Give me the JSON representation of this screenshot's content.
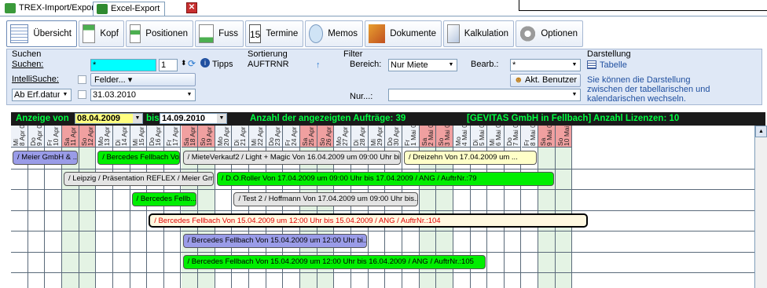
{
  "top_tabs": [
    {
      "label": "TREX-Import/Export",
      "icon": "trex-icon"
    },
    {
      "label": "Excel-Export",
      "icon": "excel-icon"
    }
  ],
  "toolbar": {
    "tabs": [
      {
        "label": "Übersicht",
        "icon": "overview-icon"
      },
      {
        "label": "Kopf",
        "icon": "header-icon"
      },
      {
        "label": "Positionen",
        "icon": "positions-icon"
      },
      {
        "label": "Fuss",
        "icon": "footer-icon"
      },
      {
        "label": "Termine",
        "icon": "calendar-icon",
        "icon_text": "15"
      },
      {
        "label": "Memos",
        "icon": "memo-icon"
      },
      {
        "label": "Dokumente",
        "icon": "documents-icon"
      },
      {
        "label": "Kalkulation",
        "icon": "calculation-icon"
      },
      {
        "label": "Optionen",
        "icon": "options-icon"
      }
    ]
  },
  "search": {
    "title": "Suchen",
    "suchen_label": "Suchen:",
    "suchen_value": "*",
    "count_value": "1",
    "tipps_label": "Tipps",
    "intelli_label": "IntelliSuche:",
    "felder_label": "Felder...",
    "date_mode": "Ab Erf.datum",
    "date_value": "31.03.2010"
  },
  "sort": {
    "title": "Sortierung",
    "value": "AUFTRNR"
  },
  "filter": {
    "title": "Filter",
    "bereich_label": "Bereich:",
    "bereich_value": "Nur Miete",
    "bearb_label": "Bearb.:",
    "bearb_value": "*",
    "akt_button": "Akt. Benutzer",
    "nur_label": "Nur...:",
    "nur_value": ""
  },
  "display": {
    "title": "Darstellung",
    "tabelle_label": "Tabelle",
    "hint": "Sie können die Darstellung zwischen der tabellarischen und kalendarischen wechseln."
  },
  "calendar": {
    "anzeige_von": "Anzeige von",
    "from_date": "08.04.2009",
    "bis": "bis",
    "to_date": "14.09.2010",
    "count_text": "Anzahl der angezeigten Aufträge: 39",
    "license_text": "[GEVITAS GmbH in Fellbach] Anzahl Lizenzen: 10",
    "days": [
      {
        "label": "Mi\n8 Apr 09",
        "weekend": false
      },
      {
        "label": "Do\n9 Apr 09",
        "weekend": false
      },
      {
        "label": "Fr\n10 Apr 09",
        "weekend": false
      },
      {
        "label": "Sa\n11 Apr 09",
        "weekend": true
      },
      {
        "label": "So\n12 Apr 09",
        "weekend": true
      },
      {
        "label": "Mo\n13 Apr 09",
        "weekend": false
      },
      {
        "label": "Di\n14 Apr 09",
        "weekend": false
      },
      {
        "label": "Mi\n15 Apr 09",
        "weekend": false
      },
      {
        "label": "Do\n16 Apr 09",
        "weekend": false
      },
      {
        "label": "Fr\n17 Apr 09",
        "weekend": false
      },
      {
        "label": "Sa\n18 Apr 09",
        "weekend": true
      },
      {
        "label": "So\n19 Apr 09",
        "weekend": true
      },
      {
        "label": "Mo\n20 Apr 09",
        "weekend": false
      },
      {
        "label": "Di\n21 Apr 09",
        "weekend": false
      },
      {
        "label": "Mi\n22 Apr 09",
        "weekend": false
      },
      {
        "label": "Do\n23 Apr 09",
        "weekend": false
      },
      {
        "label": "Fr\n24 Apr 09",
        "weekend": false
      },
      {
        "label": "Sa\n25 Apr 09",
        "weekend": true
      },
      {
        "label": "So\n26 Apr 09",
        "weekend": true
      },
      {
        "label": "Mo\n27 Apr 09",
        "weekend": false
      },
      {
        "label": "Di\n28 Apr 09",
        "weekend": false
      },
      {
        "label": "Mi\n29 Apr 09",
        "weekend": false
      },
      {
        "label": "Do\n30 Apr 09",
        "weekend": false
      },
      {
        "label": "Fr\n1 Mai 09",
        "weekend": false
      },
      {
        "label": "Sa\n2 Mai 09",
        "weekend": true
      },
      {
        "label": "So\n3 Mai 09",
        "weekend": true
      },
      {
        "label": "Mo\n4 Mai 09",
        "weekend": false
      },
      {
        "label": "Di\n5 Mai 09",
        "weekend": false
      },
      {
        "label": "Mi\n6 Mai 09",
        "weekend": false
      },
      {
        "label": "Do\n7 Mai 09",
        "weekend": false
      },
      {
        "label": "Fr\n8 Mai 09",
        "weekend": false
      },
      {
        "label": "Sa\n9 Mai 09",
        "weekend": true
      },
      {
        "label": "So\n10 Mai 09",
        "weekend": true
      }
    ],
    "events": [
      {
        "text": "/ Meier GmbH & ...",
        "color": "purple",
        "row": 0,
        "start": 0,
        "span": 4
      },
      {
        "text": "/ Bercedes Fellbach Vo...",
        "color": "green",
        "row": 0,
        "start": 5,
        "span": 5
      },
      {
        "text": "/ MieteVerkauf2 / Light + Magic Von 16.04.2009 um 09:00 Uhr  bis 16...",
        "color": "gray",
        "row": 0,
        "start": 10,
        "span": 13
      },
      {
        "text": "/ Dreizehn Von 17.04.2009 um ...",
        "color": "yellow",
        "row": 0,
        "start": 23,
        "span": 8
      },
      {
        "text": "/ Leipzig / Präsentation REFLEX / Meier Gmb...",
        "color": "gray",
        "row": 1,
        "start": 3,
        "span": 9
      },
      {
        "text": "/ D.O.Roller Von 17.04.2009 um 09:00 Uhr  bis 17.04.2009 / ANG / AuftrNr.:79",
        "color": "green",
        "row": 1,
        "start": 12,
        "span": 20
      },
      {
        "text": "/ Bercedes Fellb...",
        "color": "green",
        "row": 2,
        "start": 7,
        "span": 4
      },
      {
        "text": "/ Test 2 / Hoffmann Von 17.04.2009 um 09:00 Uhr  bis...",
        "color": "gray",
        "row": 2,
        "start": 13,
        "span": 11
      },
      {
        "text": "/ Bercedes Fellbach Von 15.04.2009 um 12:00 Uhr  bis 15.04.2009 / ANG / AuftrNr.:104",
        "color": "red",
        "row": 3,
        "start": 8,
        "span": 26
      },
      {
        "text": "/ Bercedes Fellbach Von 15.04.2009 um 12:00 Uhr  bi...",
        "color": "purple",
        "row": 4,
        "start": 10,
        "span": 11
      },
      {
        "text": "/ Bercedes Fellbach Von 15.04.2009 um 12:00 Uhr  bis 16.04.2009 / ANG / AuftrNr.:105",
        "color": "green",
        "row": 5,
        "start": 10,
        "span": 18
      }
    ]
  }
}
